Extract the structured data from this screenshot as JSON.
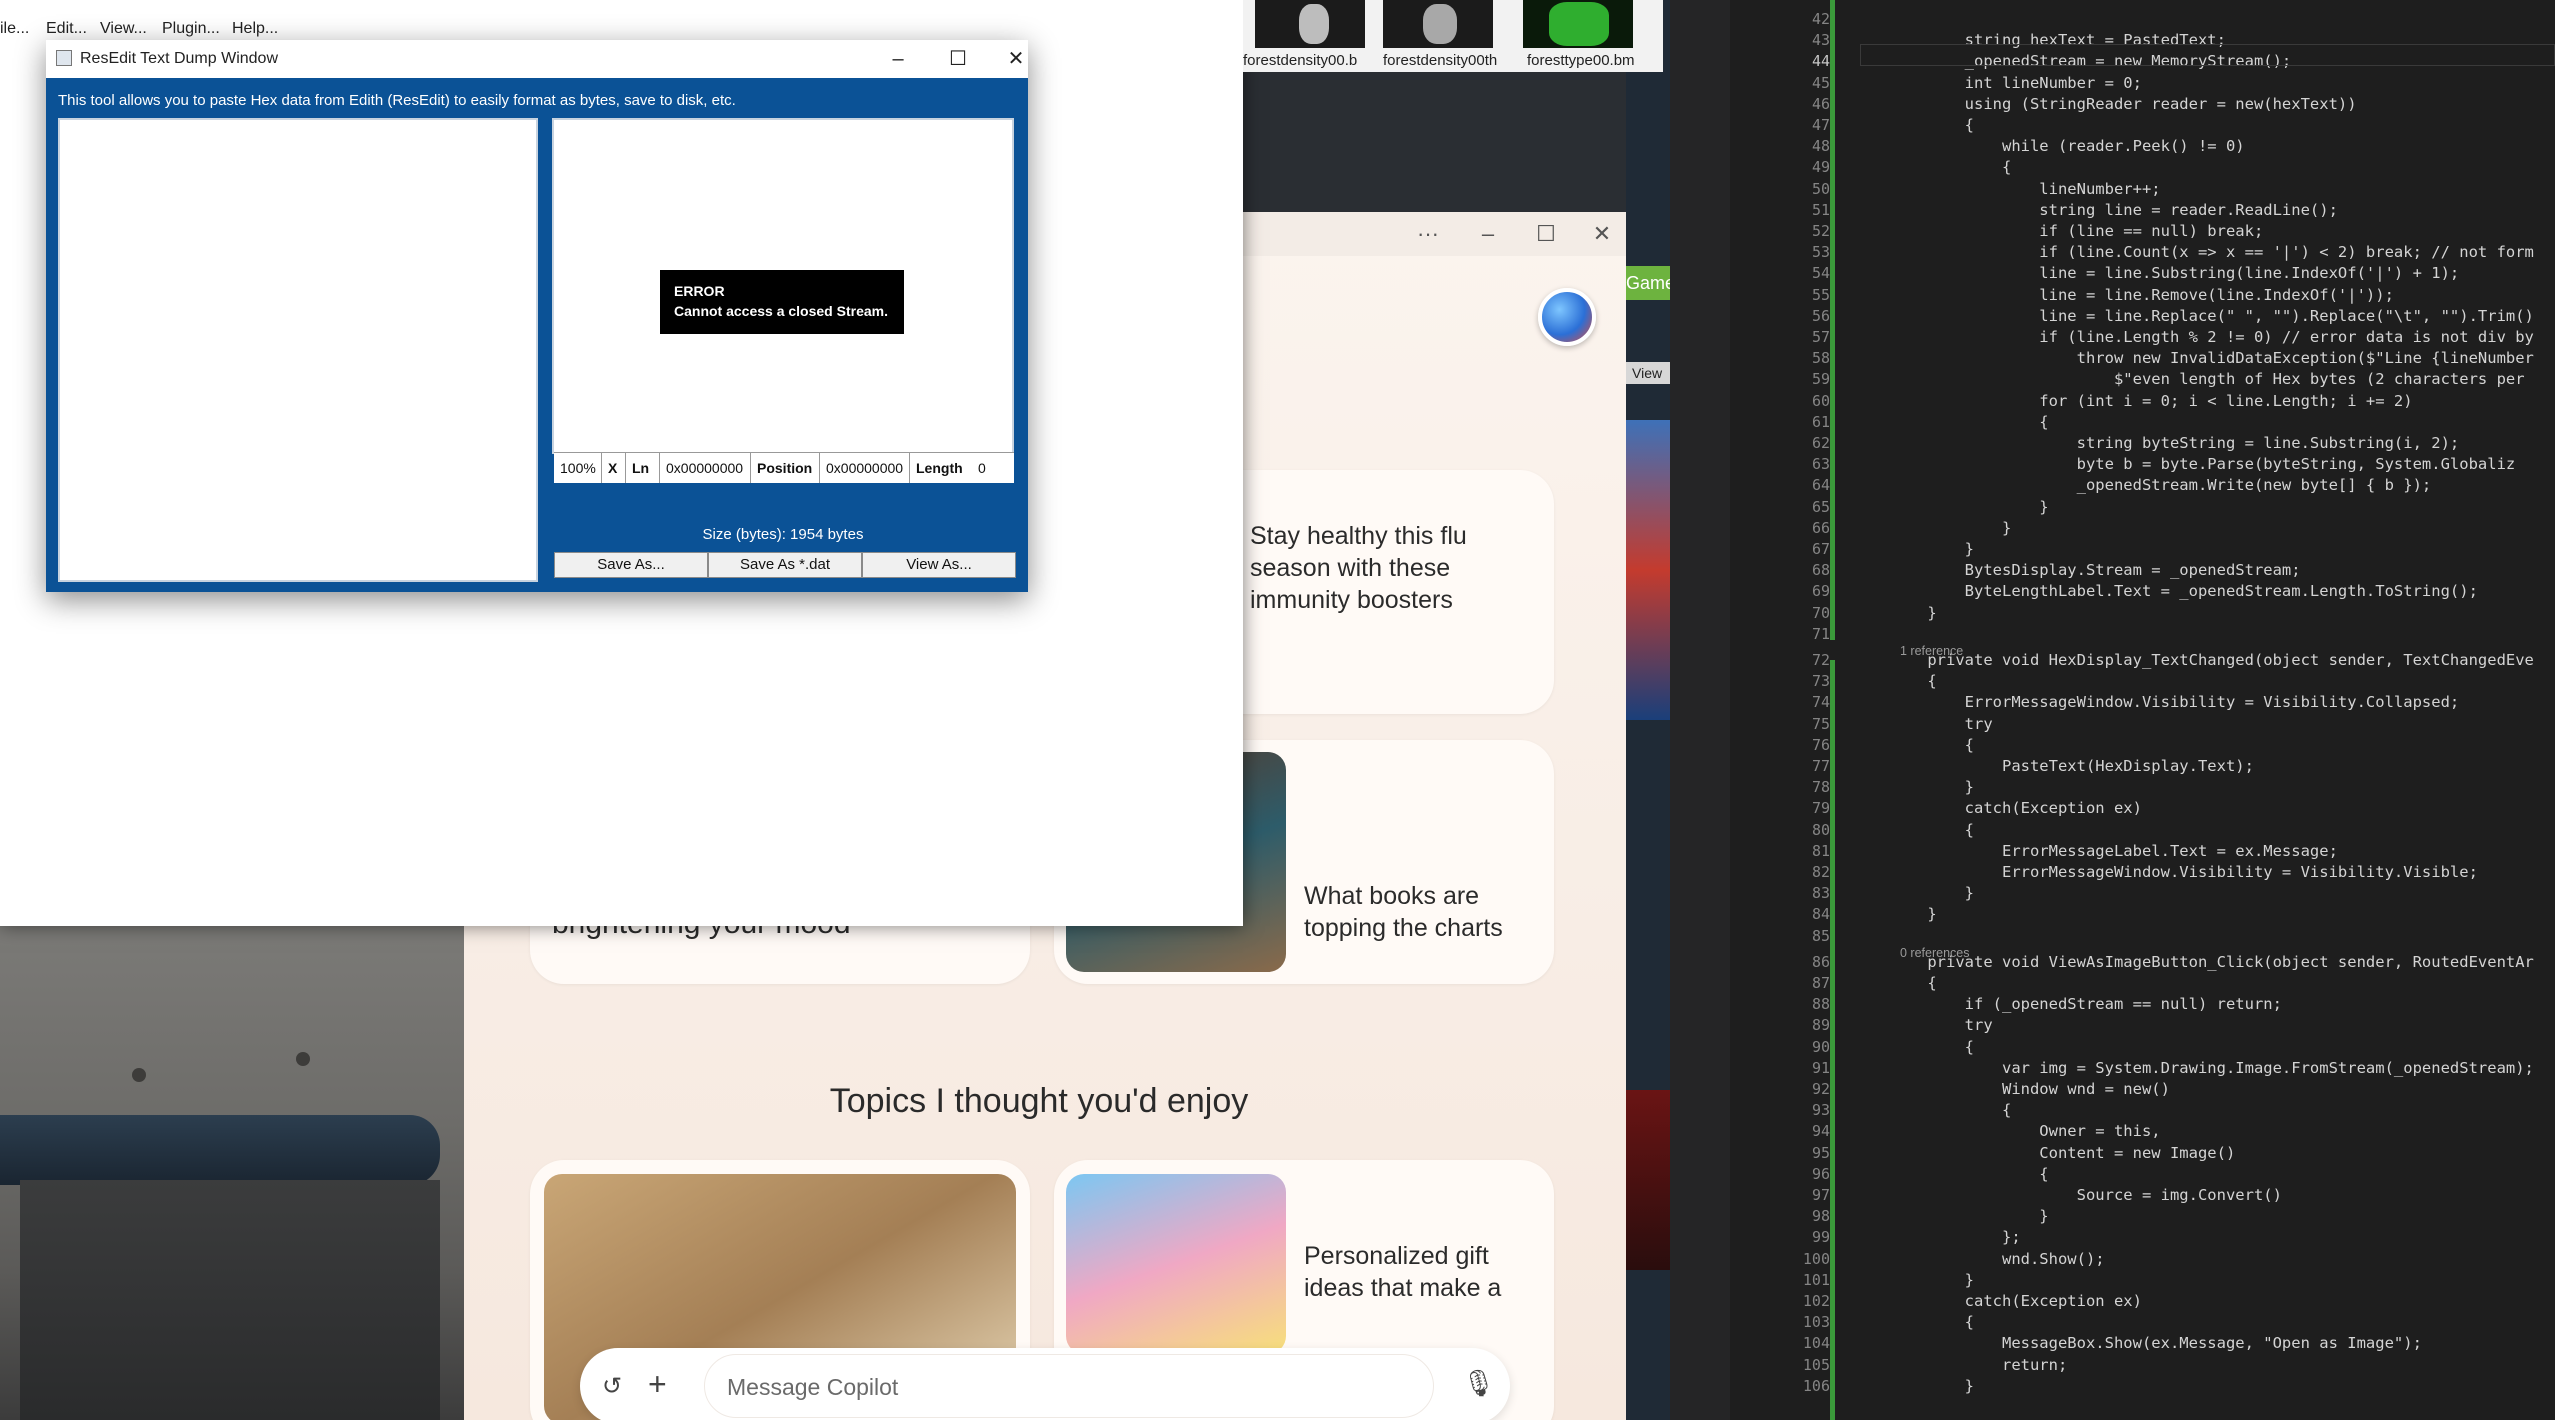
{
  "main_app": {
    "menu": [
      "ile...",
      "Edit...",
      "View...",
      "Plugin...",
      "Help..."
    ]
  },
  "thumbnails": [
    {
      "label": "forestdensity00.b",
      "color": "#cfcfcf"
    },
    {
      "label": "forestdensity00th",
      "color": "#bdbdbd"
    },
    {
      "label": "foresttype00.bm",
      "color": "#2fae2f"
    }
  ],
  "resedit": {
    "title": "ResEdit Text Dump Window",
    "description": "This tool allows you to paste Hex data from Edith (ResEdit) to easily format as bytes, save to disk, etc.",
    "error_title": "ERROR",
    "error_message": "Cannot access a closed Stream.",
    "status": {
      "zoom": "100%",
      "close": "X",
      "ln_label": "Ln",
      "ln_value": "0x00000000",
      "position_label": "Position",
      "position_value": "0x00000000",
      "length_label": "Length",
      "length_value": "0"
    },
    "size_text": "Size (bytes): 1954 bytes",
    "buttons": [
      "Save As...",
      "Save As *.dat",
      "View As..."
    ]
  },
  "copilot": {
    "cards": [
      {
        "text": "Stay healthy this flu season with these immunity boosters"
      },
      {
        "text": "What books are topping the charts"
      },
      {
        "text": "brightening your mood"
      },
      {
        "text": "Personalized gift ideas that make a"
      }
    ],
    "topics_heading": "Topics I thought you'd enjoy",
    "message_placeholder": "Message Copilot"
  },
  "game_strip": {
    "game_label": "Game",
    "view_label": "View"
  },
  "editor": {
    "lines": [
      {
        "n": "42",
        "code": ""
      },
      {
        "n": "43",
        "code": "        string hexText = PastedText;"
      },
      {
        "n": "44",
        "code": "        _openedStream = new MemoryStream();"
      },
      {
        "n": "45",
        "code": "        int lineNumber = 0;"
      },
      {
        "n": "46",
        "code": "        using (StringReader reader = new(hexText))"
      },
      {
        "n": "47",
        "code": "        {"
      },
      {
        "n": "48",
        "code": "            while (reader.Peek() != 0)"
      },
      {
        "n": "49",
        "code": "            {"
      },
      {
        "n": "50",
        "code": "                lineNumber++;"
      },
      {
        "n": "51",
        "code": "                string line = reader.ReadLine();"
      },
      {
        "n": "52",
        "code": "                if (line == null) break;"
      },
      {
        "n": "53",
        "code": "                if (line.Count(x => x == '|') < 2) break; // not form"
      },
      {
        "n": "54",
        "code": "                line = line.Substring(line.IndexOf('|') + 1);"
      },
      {
        "n": "55",
        "code": "                line = line.Remove(line.IndexOf('|'));"
      },
      {
        "n": "56",
        "code": "                line = line.Replace(\" \", \"\").Replace(\"\\t\", \"\").Trim()"
      },
      {
        "n": "57",
        "code": "                if (line.Length % 2 != 0) // error data is not div by"
      },
      {
        "n": "58",
        "code": "                    throw new InvalidDataException($\"Line {lineNumber"
      },
      {
        "n": "59",
        "code": "                        $\"even length of Hex bytes (2 characters per"
      },
      {
        "n": "60",
        "code": "                for (int i = 0; i < line.Length; i += 2)"
      },
      {
        "n": "61",
        "code": "                {"
      },
      {
        "n": "62",
        "code": "                    string byteString = line.Substring(i, 2);"
      },
      {
        "n": "63",
        "code": "                    byte b = byte.Parse(byteString, System.Globaliz"
      },
      {
        "n": "64",
        "code": "                    _openedStream.Write(new byte[] { b });"
      },
      {
        "n": "65",
        "code": "                }"
      },
      {
        "n": "66",
        "code": "            }"
      },
      {
        "n": "67",
        "code": "        }"
      },
      {
        "n": "68",
        "code": "        BytesDisplay.Stream = _openedStream;"
      },
      {
        "n": "69",
        "code": "        ByteLengthLabel.Text = _openedStream.Length.ToString();"
      },
      {
        "n": "70",
        "code": "    }"
      },
      {
        "n": "71",
        "code": ""
      },
      {
        "n": "72",
        "code": "    private void HexDisplay_TextChanged(object sender, TextChangedEve",
        "ref": "1 reference"
      },
      {
        "n": "73",
        "code": "    {"
      },
      {
        "n": "74",
        "code": "        ErrorMessageWindow.Visibility = Visibility.Collapsed;"
      },
      {
        "n": "75",
        "code": "        try"
      },
      {
        "n": "76",
        "code": "        {"
      },
      {
        "n": "77",
        "code": "            PasteText(HexDisplay.Text);"
      },
      {
        "n": "78",
        "code": "        }"
      },
      {
        "n": "79",
        "code": "        catch(Exception ex)"
      },
      {
        "n": "80",
        "code": "        {"
      },
      {
        "n": "81",
        "code": "            ErrorMessageLabel.Text = ex.Message;"
      },
      {
        "n": "82",
        "code": "            ErrorMessageWindow.Visibility = Visibility.Visible;"
      },
      {
        "n": "83",
        "code": "        }"
      },
      {
        "n": "84",
        "code": "    }"
      },
      {
        "n": "85",
        "code": ""
      },
      {
        "n": "86",
        "code": "    private void ViewAsImageButton_Click(object sender, RoutedEventAr",
        "ref": "0 references"
      },
      {
        "n": "87",
        "code": "    {"
      },
      {
        "n": "88",
        "code": "        if (_openedStream == null) return;"
      },
      {
        "n": "89",
        "code": "        try"
      },
      {
        "n": "90",
        "code": "        {"
      },
      {
        "n": "91",
        "code": "            var img = System.Drawing.Image.FromStream(_openedStream);"
      },
      {
        "n": "92",
        "code": "            Window wnd = new()"
      },
      {
        "n": "93",
        "code": "            {"
      },
      {
        "n": "94",
        "code": "                Owner = this,"
      },
      {
        "n": "95",
        "code": "                Content = new Image()"
      },
      {
        "n": "96",
        "code": "                {"
      },
      {
        "n": "97",
        "code": "                    Source = img.Convert()"
      },
      {
        "n": "98",
        "code": "                }"
      },
      {
        "n": "99",
        "code": "            };"
      },
      {
        "n": "100",
        "code": "            wnd.Show();"
      },
      {
        "n": "101",
        "code": "        }"
      },
      {
        "n": "102",
        "code": "        catch(Exception ex)"
      },
      {
        "n": "103",
        "code": "        {"
      },
      {
        "n": "104",
        "code": "            MessageBox.Show(ex.Message, \"Open as Image\");"
      },
      {
        "n": "105",
        "code": "            return;"
      },
      {
        "n": "106",
        "code": "        }"
      }
    ]
  }
}
